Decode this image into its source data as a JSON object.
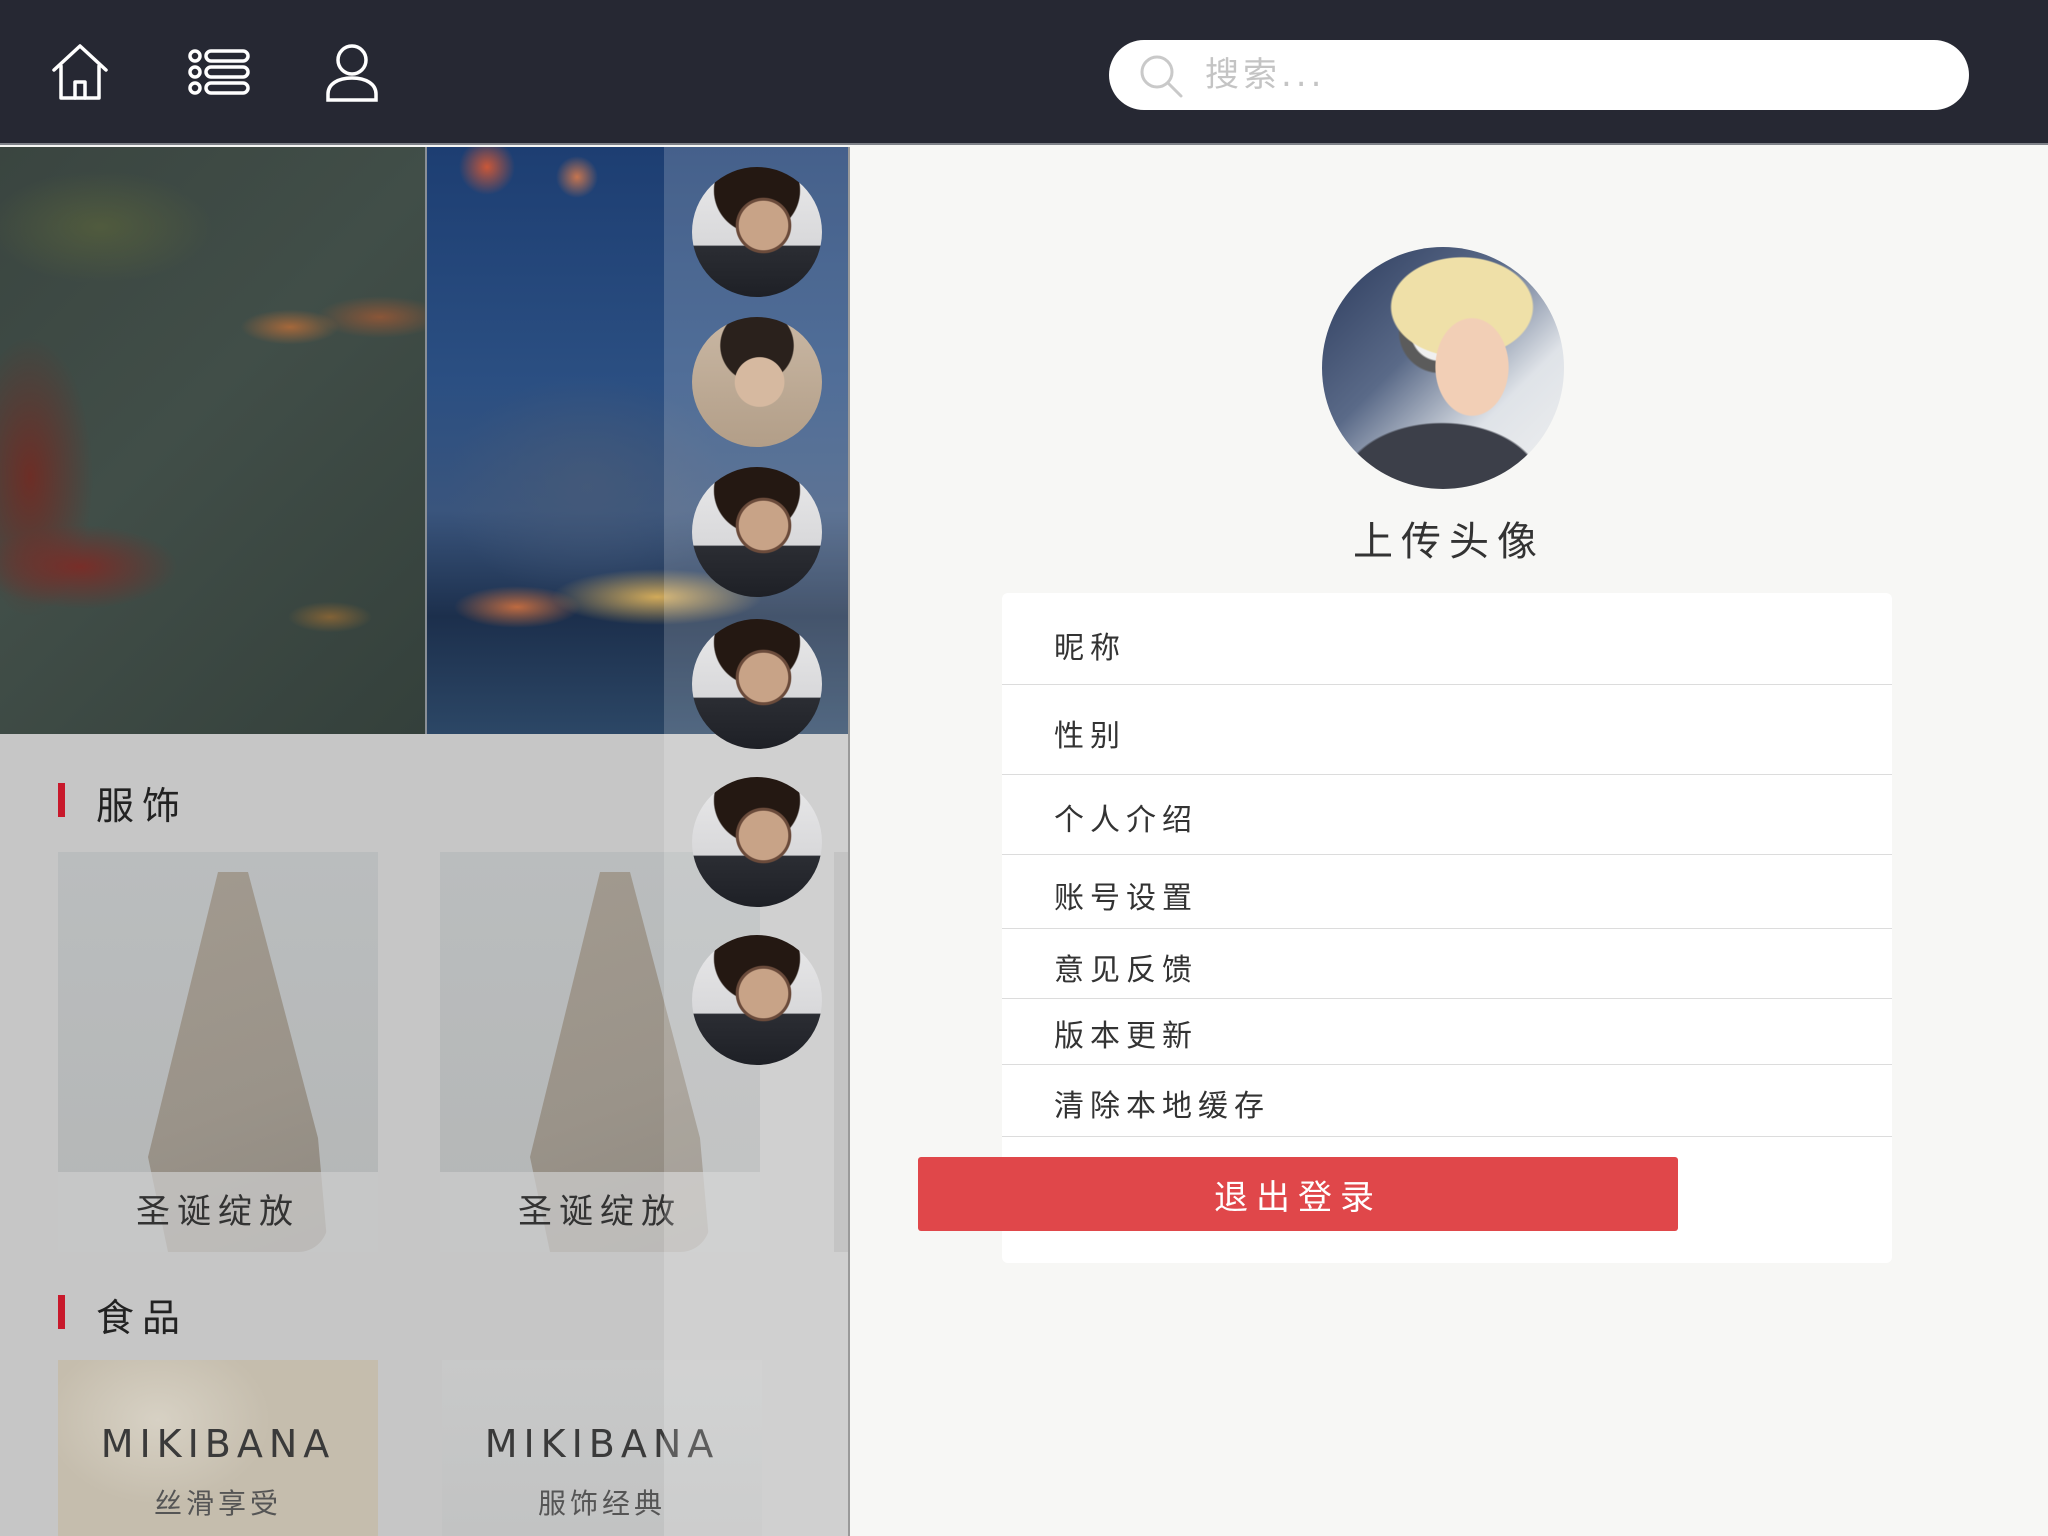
{
  "topbar": {
    "icons": [
      "home-icon",
      "list-icon",
      "user-icon"
    ],
    "search": {
      "placeholder": "搜索...",
      "value": ""
    }
  },
  "left": {
    "sections": [
      {
        "title": "服饰",
        "cards": [
          {
            "caption": "圣诞绽放"
          },
          {
            "caption": "圣诞绽放"
          }
        ]
      },
      {
        "title": "食品",
        "cards": [
          {
            "brand": "MIKIBANA",
            "sub": "丝滑享受"
          },
          {
            "brand": "MIKIBANA",
            "sub": "服饰经典"
          }
        ]
      }
    ]
  },
  "profile": {
    "upload_label": "上传头像",
    "menu": [
      "昵称",
      "性别",
      "个人介绍",
      "账号设置",
      "意见反馈",
      "版本更新",
      "清除本地缓存"
    ],
    "logout_label": "退出登录"
  },
  "colors": {
    "topbar": "#262833",
    "accent_red": "#e0474a",
    "section_marker": "#c8182b",
    "background": "#f7f7f5"
  }
}
